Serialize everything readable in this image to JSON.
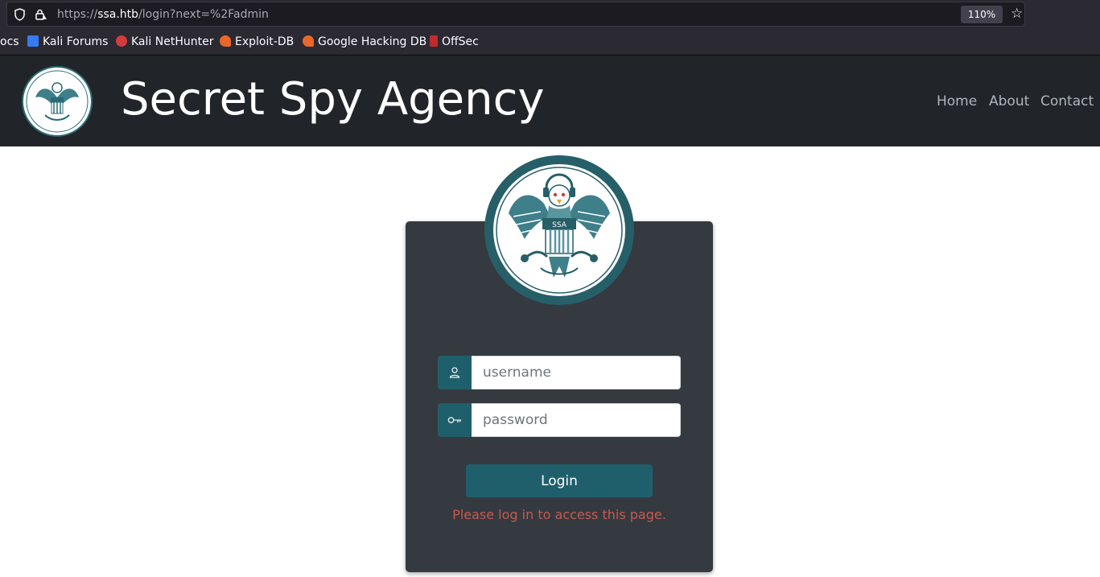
{
  "browser": {
    "url_prefix": "https://",
    "url_host": "ssa.htb",
    "url_path": "/login?next=%2Fadmin",
    "zoom": "110%",
    "bookmarks": [
      {
        "label": "ocs",
        "color": ""
      },
      {
        "label": "Kali Forums",
        "color": "#367bf0"
      },
      {
        "label": "Kali NetHunter",
        "color": "#d23c3c"
      },
      {
        "label": "Exploit-DB",
        "color": "#e8672a"
      },
      {
        "label": "Google Hacking DB",
        "color": "#e8672a"
      },
      {
        "label": "OffSec",
        "color": "#c22b2b"
      }
    ]
  },
  "site": {
    "title": "Secret Spy Agency",
    "nav": [
      "Home",
      "About",
      "Contact"
    ],
    "seal_text": "SSA"
  },
  "login": {
    "username_placeholder": "username",
    "password_placeholder": "password",
    "button_label": "Login",
    "flash_message": "Please log in to access this page."
  },
  "colors": {
    "header_bg": "#212529",
    "card_bg": "#343a40",
    "accent": "#1f5f6b",
    "flash": "#c8584f"
  }
}
